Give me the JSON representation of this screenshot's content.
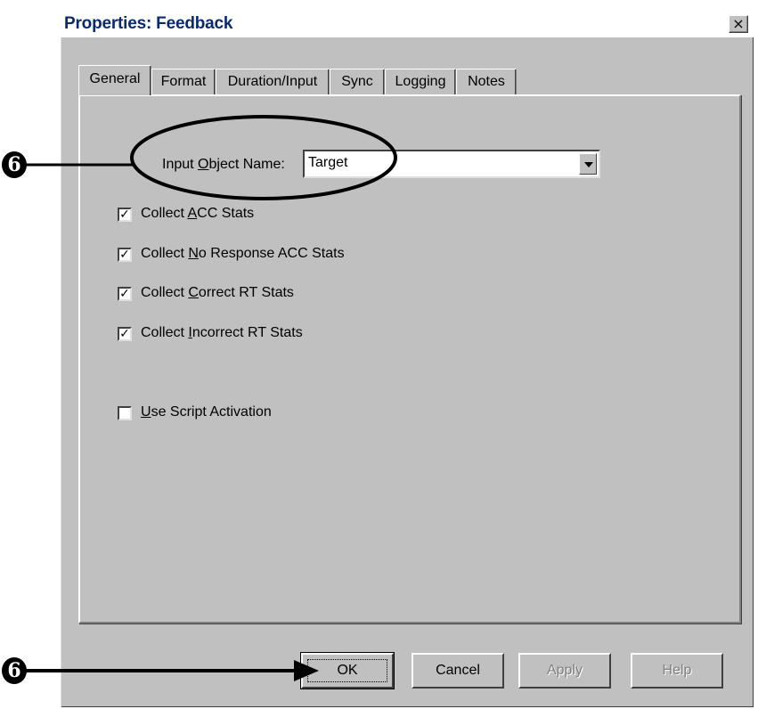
{
  "window": {
    "title": "Properties: Feedback",
    "close_label": "×"
  },
  "tabs": [
    {
      "label": "General",
      "active": true
    },
    {
      "label": "Format",
      "active": false
    },
    {
      "label": "Duration/Input",
      "active": false
    },
    {
      "label": "Sync",
      "active": false
    },
    {
      "label": "Logging",
      "active": false
    },
    {
      "label": "Notes",
      "active": false
    }
  ],
  "general": {
    "input_object_label_pre": "Input ",
    "input_object_label_key": "O",
    "input_object_label_post": "bject Name:",
    "input_object_value": "Target",
    "checkboxes": [
      {
        "pre": "Collect ",
        "key": "A",
        "post": "CC Stats",
        "checked": "✓"
      },
      {
        "pre": "Collect ",
        "key": "N",
        "post": "o Response ACC Stats",
        "checked": "✓"
      },
      {
        "pre": "Collect ",
        "key": "C",
        "post": "orrect RT Stats",
        "checked": "✓"
      },
      {
        "pre": "Collect ",
        "key": "I",
        "post": "ncorrect RT Stats",
        "checked": "✓"
      },
      {
        "pre": "",
        "key": "U",
        "post": "se Script Activation",
        "checked": ""
      }
    ]
  },
  "buttons": {
    "ok": "OK",
    "cancel": "Cancel",
    "apply": "Apply",
    "help": "Help"
  },
  "annotations": {
    "marker_top": "6",
    "marker_bottom": "6"
  }
}
